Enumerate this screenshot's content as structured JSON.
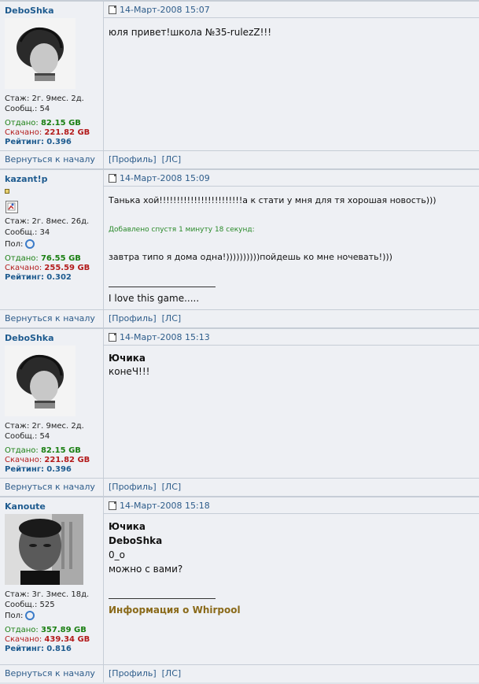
{
  "common": {
    "back_label": "Вернуться к началу",
    "profile_label": "[Профиль]",
    "pm_label": "[ЛС]"
  },
  "posts": [
    {
      "user": "DeboShka",
      "stazh": "Стаж: 2г. 9мес. 2д.",
      "soobsh": "Сообщ.: 54",
      "otdano_label": "Отдано:",
      "otdano": "82.15 GB",
      "skachano_label": "Скачано:",
      "skachano": "221.82 GB",
      "rating_label": "Рейтинг:",
      "rating": "0.396",
      "date": "14-Март-2008 15:07",
      "message": "юля привет!школа №35-rulezZ!!!"
    },
    {
      "user": "kazant!p",
      "stazh": "Стаж: 2г. 8мес. 26д.",
      "soobsh": "Сообщ.: 34",
      "pol": "Пол:",
      "otdano_label": "Отдано:",
      "otdano": "76.55 GB",
      "skachano_label": "Скачано:",
      "skachano": "255.59 GB",
      "rating_label": "Рейтинг:",
      "rating": "0.302",
      "date": "14-Март-2008 15:09",
      "message1": "Танька хой!!!!!!!!!!!!!!!!!!!!!!!!а к стати у мня для тя хорошая новость)))",
      "added": "Добавлено спустя 1 минуту 18 секунд:",
      "message2": "завтра типо я дома одна!))))))))))пойдешь ко мне ночевать!)))",
      "signature": "I love this game....."
    },
    {
      "user": "DeboShka",
      "stazh": "Стаж: 2г. 9мес. 2д.",
      "soobsh": "Сообщ.: 54",
      "otdano_label": "Отдано:",
      "otdano": "82.15 GB",
      "skachano_label": "Скачано:",
      "skachano": "221.82 GB",
      "rating_label": "Рейтинг:",
      "rating": "0.396",
      "date": "14-Март-2008 15:13",
      "quote_name": "Ючика",
      "message": "конеЧ!!!"
    },
    {
      "user": "Kanoute",
      "stazh": "Стаж: 3г. 3мес. 18д.",
      "soobsh": "Сообщ.: 525",
      "pol": "Пол:",
      "otdano_label": "Отдано:",
      "otdano": "357.89 GB",
      "skachano_label": "Скачано:",
      "skachano": "439.34 GB",
      "rating_label": "Рейтинг:",
      "rating": "0.816",
      "date": "14-Март-2008 15:18",
      "quote_name1": "Ючика",
      "quote_name2": "DeboShka",
      "line1": "0_о",
      "line2": "можно с вами?",
      "signature": "Информация о Whirpool"
    }
  ]
}
